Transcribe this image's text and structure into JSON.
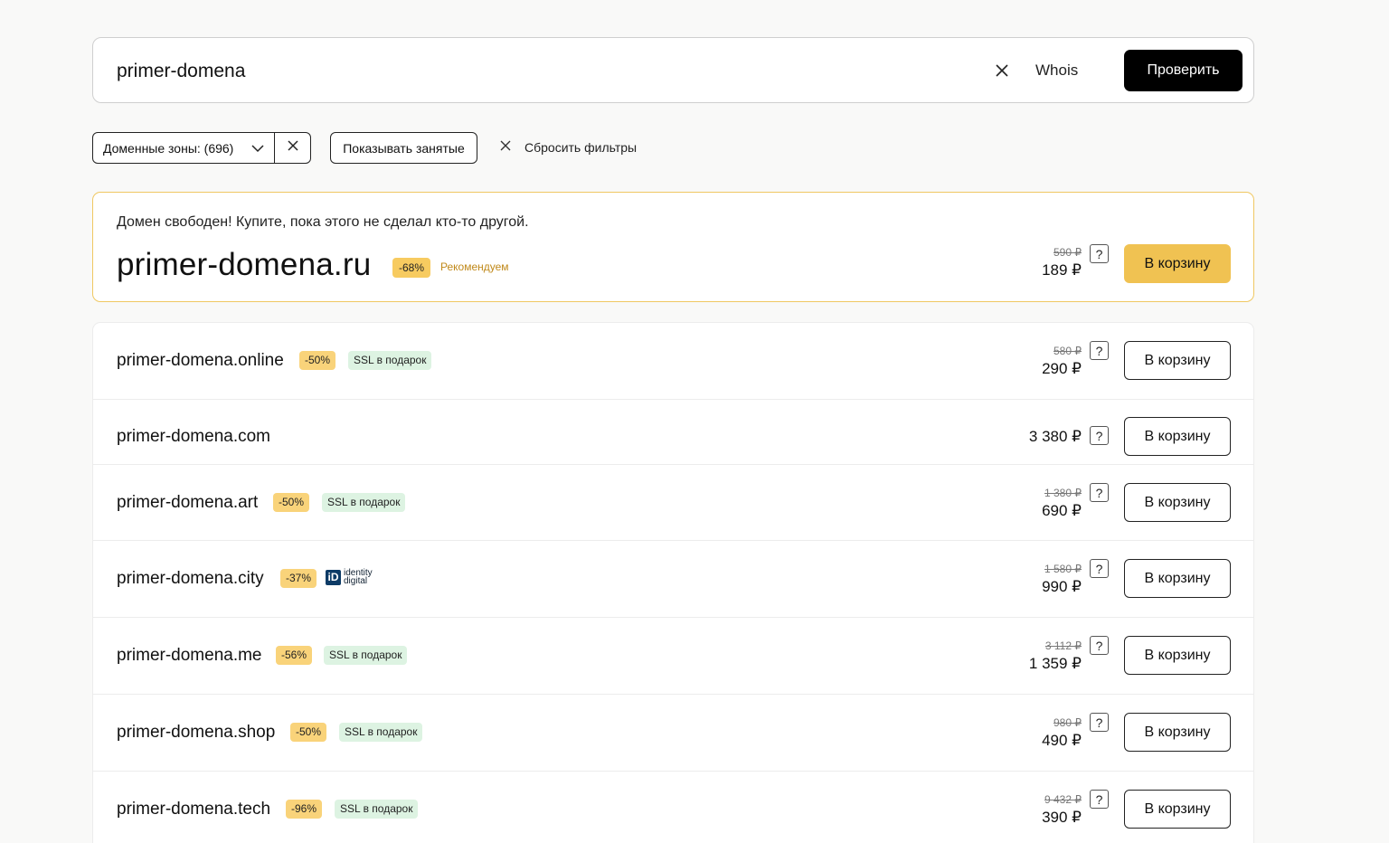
{
  "search": {
    "value": "primer-domena",
    "whois_label": "Whois",
    "check_label": "Проверить"
  },
  "filters": {
    "zones_label": "Доменные зоны: (696)",
    "show_taken_label": "Показывать занятые",
    "reset_label": "Сбросить фильтры"
  },
  "featured": {
    "message": "Домен свободен! Купите, пока этого не сделал кто-то другой.",
    "domain": "primer-domena.ru",
    "discount": "-68%",
    "tag": "Рекомендуем",
    "old_price": "590 ₽",
    "price": "189 ₽",
    "help": "?",
    "cart_label": "В корзину"
  },
  "domains": [
    {
      "name": "primer-domena.online",
      "discount": "-50%",
      "ssl": "SSL в подарок",
      "old_price": "580 ₽",
      "price": "290 ₽",
      "help": "?",
      "cart_label": "В корзину"
    },
    {
      "name": "primer-domena.com",
      "price": "3 380 ₽",
      "help": "?",
      "cart_label": "В корзину"
    },
    {
      "name": "primer-domena.art",
      "discount": "-50%",
      "ssl": "SSL в подарок",
      "old_price": "1 380 ₽",
      "price": "690 ₽",
      "help": "?",
      "cart_label": "В корзину"
    },
    {
      "name": "primer-domena.city",
      "discount": "-37%",
      "partner_line1": "identity",
      "partner_line2": "digital",
      "old_price": "1 580 ₽",
      "price": "990 ₽",
      "help": "?",
      "cart_label": "В корзину"
    },
    {
      "name": "primer-domena.me",
      "discount": "-56%",
      "ssl": "SSL в подарок",
      "old_price": "3 112 ₽",
      "price": "1 359 ₽",
      "help": "?",
      "cart_label": "В корзину"
    },
    {
      "name": "primer-domena.shop",
      "discount": "-50%",
      "ssl": "SSL в подарок",
      "old_price": "980 ₽",
      "price": "490 ₽",
      "help": "?",
      "cart_label": "В корзину"
    },
    {
      "name": "primer-domena.tech",
      "discount": "-96%",
      "ssl": "SSL в подарок",
      "old_price": "9 432 ₽",
      "price": "390 ₽",
      "help": "?",
      "cart_label": "В корзину"
    }
  ]
}
